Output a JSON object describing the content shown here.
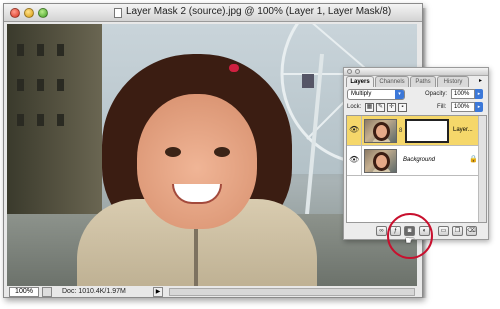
{
  "window": {
    "title": "Layer Mask 2 (source).jpg @ 100% (Layer 1, Layer Mask/8)"
  },
  "status_bar": {
    "zoom": "100%",
    "doc_size": "Doc: 1010.4K/1.97M",
    "menu_arrow": "▶"
  },
  "palette": {
    "tabs": [
      {
        "label": "Layers",
        "active": true
      },
      {
        "label": "Channels",
        "active": false
      },
      {
        "label": "Paths",
        "active": false
      },
      {
        "label": "History",
        "active": false
      }
    ],
    "menu_arrow": "▸",
    "blend_mode": "Multiply",
    "opacity_label": "Opacity:",
    "opacity_value": "100%",
    "lock_label": "Lock:",
    "fill_label": "Fill:",
    "fill_value": "100%",
    "layers": [
      {
        "name": "Layer...",
        "selected": true,
        "has_mask": true
      },
      {
        "name": "Background",
        "selected": false,
        "locked": true
      }
    ],
    "bottom_icons": [
      "link-icon",
      "layer-style-icon",
      "add-layer-mask-icon",
      "adjustment-layer-icon",
      "new-group-icon",
      "new-layer-icon",
      "trash-icon"
    ]
  },
  "colors": {
    "highlight_ring": "#c8102e",
    "selected_layer": "#f5d76a",
    "accent": "#3c78d8"
  },
  "icons": {
    "eye": "👁",
    "lock": "🔒",
    "chain": "8",
    "cursor": "☛"
  }
}
